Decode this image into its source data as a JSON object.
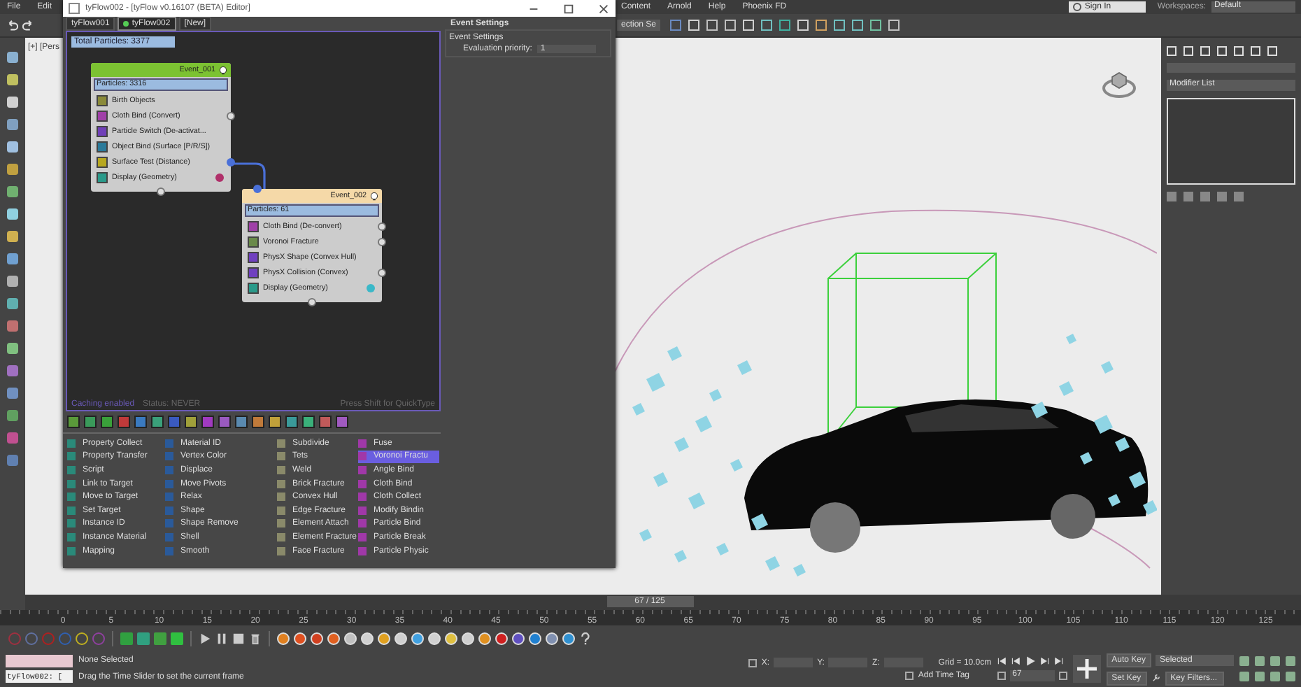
{
  "menu_bar": {
    "left_items": [
      "File",
      "Edit"
    ],
    "right_items": [
      "Content",
      "Arnold",
      "Help",
      "Phoenix FD"
    ],
    "sign_in": "Sign In",
    "workspaces_label": "Workspaces:",
    "workspace": "Default"
  },
  "main_toolbar": {
    "selection_set": "ection Se"
  },
  "viewport": {
    "label": "[+] [Pers"
  },
  "tyflow_editor": {
    "title": "tyFlow002 - [tyFlow v0.16107 (BETA) Editor]",
    "tabs": [
      {
        "label": "tyFlow001",
        "selected": false
      },
      {
        "label": "tyFlow002",
        "selected": true
      },
      {
        "label": "[New]",
        "selected": false
      }
    ],
    "total_particles": "Total Particles: 3377",
    "events": [
      {
        "title": "Event_001",
        "particles": "Particles: 3316",
        "color": "#7cc232",
        "operators": [
          {
            "name": "Birth Objects",
            "kind": "birth"
          },
          {
            "name": "Cloth Bind (Convert)",
            "kind": "bind",
            "output": true
          },
          {
            "name": "Particle Switch (De-activat...",
            "kind": "switch"
          },
          {
            "name": "Object Bind (Surface [P/R/S])",
            "kind": "object"
          },
          {
            "name": "Surface Test (Distance)",
            "kind": "test",
            "output": true,
            "connected": true
          },
          {
            "name": "Display (Geometry)",
            "kind": "display",
            "color": "#b0306a"
          }
        ]
      },
      {
        "title": "Event_002",
        "particles": "Particles: 61",
        "color": "#f5d9a8",
        "operators": [
          {
            "name": "Cloth Bind (De-convert)",
            "kind": "bind",
            "output": true
          },
          {
            "name": "Voronoi Fracture",
            "kind": "fracture",
            "output": true
          },
          {
            "name": "PhysX Shape (Convex Hull)",
            "kind": "physx"
          },
          {
            "name": "PhysX Collision (Convex)",
            "kind": "physx",
            "output": true
          },
          {
            "name": "Display (Geometry)",
            "kind": "display",
            "color": "#3ab8c8"
          }
        ]
      }
    ],
    "status": {
      "caching": "Caching enabled",
      "state": "Status: NEVER",
      "hint": "Press Shift for QuickType"
    },
    "operator_columns": [
      [
        {
          "name": "Property Collect",
          "selected": false
        },
        {
          "name": "Property Transfer",
          "selected": false
        },
        {
          "name": "Script",
          "selected": false
        },
        {
          "name": "Link to Target",
          "selected": false
        },
        {
          "name": "Move to Target",
          "selected": false
        },
        {
          "name": "Set Target",
          "selected": false
        },
        {
          "name": "Instance ID",
          "selected": false
        },
        {
          "name": "Instance Material",
          "selected": false
        },
        {
          "name": "Mapping",
          "selected": false
        }
      ],
      [
        {
          "name": "Material ID",
          "selected": false
        },
        {
          "name": "Vertex Color",
          "selected": false
        },
        {
          "name": "Displace",
          "selected": false
        },
        {
          "name": "Move Pivots",
          "selected": false
        },
        {
          "name": "Relax",
          "selected": false
        },
        {
          "name": "Shape",
          "selected": false
        },
        {
          "name": "Shape Remove",
          "selected": false
        },
        {
          "name": "Shell",
          "selected": false
        },
        {
          "name": "Smooth",
          "selected": false
        }
      ],
      [
        {
          "name": "Subdivide",
          "selected": false
        },
        {
          "name": "Tets",
          "selected": false
        },
        {
          "name": "Weld",
          "selected": false
        },
        {
          "name": "Brick Fracture",
          "selected": false
        },
        {
          "name": "Convex Hull",
          "selected": false
        },
        {
          "name": "Edge Fracture",
          "selected": false
        },
        {
          "name": "Element Attach",
          "selected": false
        },
        {
          "name": "Element Fracture",
          "selected": false
        },
        {
          "name": "Face Fracture",
          "selected": false
        }
      ],
      [
        {
          "name": "Fuse",
          "selected": false
        },
        {
          "name": "Voronoi Fractu",
          "selected": true
        },
        {
          "name": "Angle Bind",
          "selected": false
        },
        {
          "name": "Cloth Bind",
          "selected": false
        },
        {
          "name": "Cloth Collect",
          "selected": false
        },
        {
          "name": "Modify Bindin",
          "selected": false
        },
        {
          "name": "Particle Bind",
          "selected": false
        },
        {
          "name": "Particle Break",
          "selected": false
        },
        {
          "name": "Particle Physic",
          "selected": false
        }
      ]
    ],
    "event_settings": {
      "title": "Event Settings",
      "group": "Event Settings",
      "label": "Evaluation priority:",
      "value": "1"
    }
  },
  "command_panel": {
    "modifier_list": "Modifier List"
  },
  "timeline": {
    "position": "67 / 125",
    "level": 0.536,
    "ticks": [
      "0",
      "5",
      "10",
      "15",
      "20",
      "25",
      "30",
      "35",
      "40",
      "45",
      "50",
      "55",
      "60",
      "65",
      "70",
      "75",
      "80",
      "85",
      "90",
      "95",
      "100",
      "105",
      "110",
      "115",
      "120",
      "125"
    ]
  },
  "status_bar": {
    "script_output": "tyFlow002: [",
    "selection": "None Selected",
    "prompt": "Drag the Time Slider to set the current frame",
    "x_label": "X:",
    "y_label": "Y:",
    "z_label": "Z:",
    "grid": "Grid = 10.0cm",
    "add_time_tag": "Add Time Tag",
    "frame": "67",
    "auto_key": "Auto Key",
    "key_mode": "Selected",
    "set_key": "Set Key",
    "key_filters": "Key Filters..."
  }
}
